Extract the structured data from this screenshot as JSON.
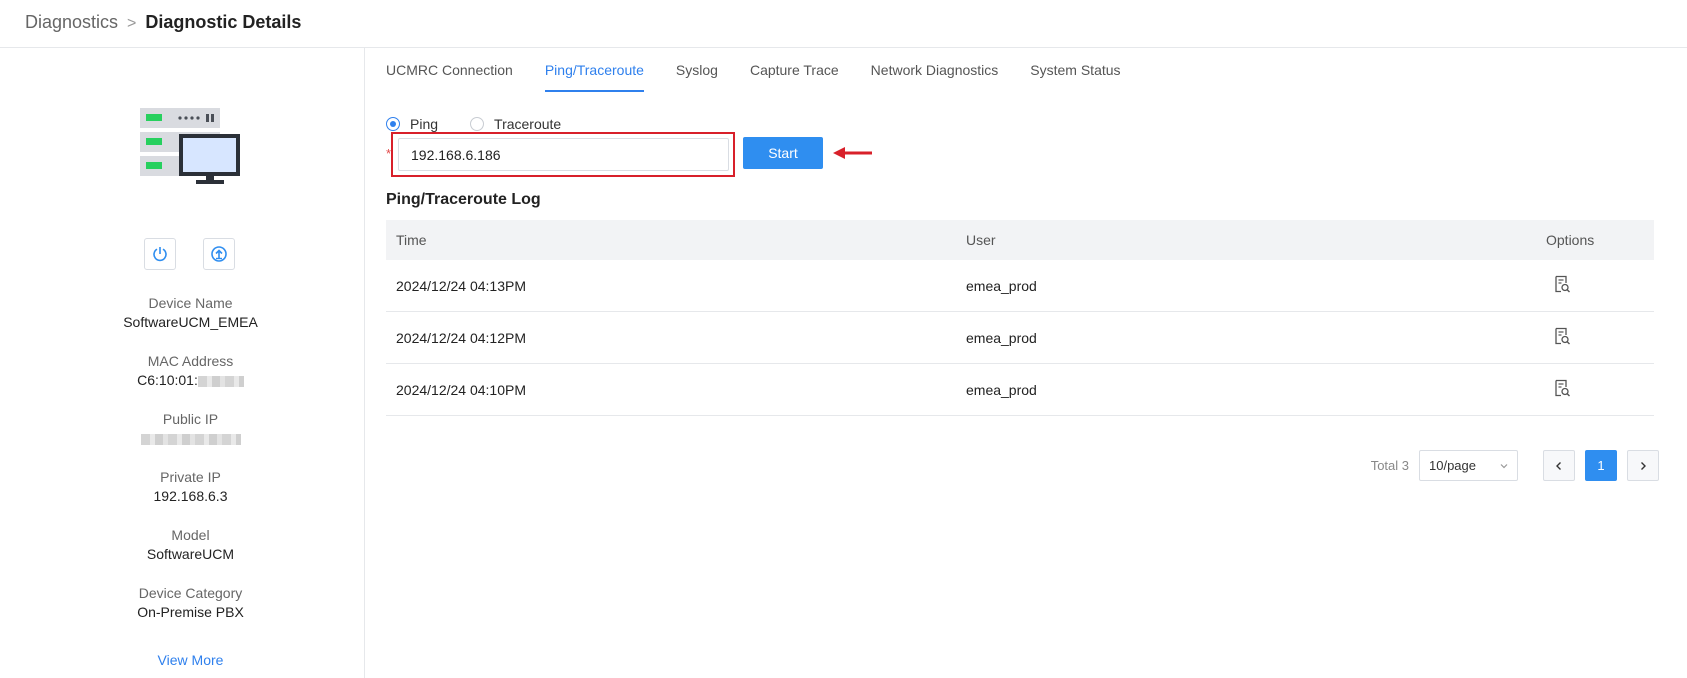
{
  "breadcrumb": {
    "parent": "Diagnostics",
    "separator": ">",
    "current": "Diagnostic Details"
  },
  "sidebar": {
    "actions": [
      {
        "icon": "power-icon"
      },
      {
        "icon": "upload-icon"
      }
    ],
    "fields": {
      "device_name": {
        "label": "Device Name",
        "value": "SoftwareUCM_EMEA"
      },
      "mac_address": {
        "label": "MAC Address",
        "value": "C6:10:01:"
      },
      "public_ip": {
        "label": "Public IP",
        "value": ""
      },
      "private_ip": {
        "label": "Private IP",
        "value": "192.168.6.3"
      },
      "model": {
        "label": "Model",
        "value": "SoftwareUCM"
      },
      "device_category": {
        "label": "Device Category",
        "value": "On-Premise PBX"
      }
    },
    "view_more": "View More"
  },
  "tabs": [
    {
      "label": "UCMRC Connection",
      "active": false
    },
    {
      "label": "Ping/Traceroute",
      "active": true
    },
    {
      "label": "Syslog",
      "active": false
    },
    {
      "label": "Capture Trace",
      "active": false
    },
    {
      "label": "Network Diagnostics",
      "active": false
    },
    {
      "label": "System Status",
      "active": false
    }
  ],
  "mode": {
    "options": [
      {
        "label": "Ping",
        "checked": true
      },
      {
        "label": "Traceroute",
        "checked": false
      }
    ]
  },
  "form": {
    "required_mark": "*",
    "ip_value": "192.168.6.186",
    "start_label": "Start"
  },
  "log": {
    "title": "Ping/Traceroute Log",
    "columns": {
      "time": "Time",
      "user": "User",
      "options": "Options"
    },
    "rows": [
      {
        "time": "2024/12/24 04:13PM",
        "user": "emea_prod",
        "option_icon": "view-report-icon"
      },
      {
        "time": "2024/12/24 04:12PM",
        "user": "emea_prod",
        "option_icon": "view-report-icon"
      },
      {
        "time": "2024/12/24 04:10PM",
        "user": "emea_prod",
        "option_icon": "view-report-icon"
      }
    ]
  },
  "pagination": {
    "total_label": "Total 3",
    "page_size": "10/page",
    "current_page": "1"
  },
  "colors": {
    "accent": "#2f8ef0",
    "highlight": "#d8202a",
    "device_green": "#27d05e"
  }
}
